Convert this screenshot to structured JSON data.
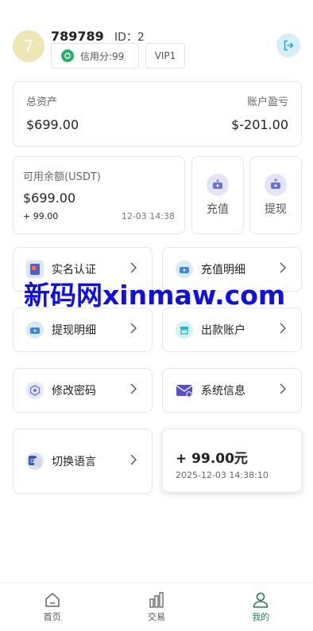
{
  "user": {
    "avatar_letter": "7",
    "name": "789789",
    "id_text": "ID：2",
    "credit_label": "信用分:99",
    "vip_label": "VIP1"
  },
  "assets": {
    "total_label": "总资产",
    "total_value": "$699.00",
    "pnl_label": "账户盈亏",
    "pnl_value": "$-201.00"
  },
  "balance": {
    "label": "可用余额(USDT)",
    "value": "$699.00",
    "change": "+ 99.00",
    "time": "12-03 14:38"
  },
  "actions": {
    "deposit": "充值",
    "withdraw": "提现"
  },
  "menu": {
    "verify": "实名认证",
    "deposit_detail": "充值明细",
    "withdraw_detail": "提现明细",
    "payout_account": "出款账户",
    "change_password": "修改密码",
    "system_message": "系统信息",
    "switch_language": "切换语言"
  },
  "toast": {
    "amount": "+ 99.00元",
    "time": "2025-12-03 14:38:10"
  },
  "watermark": "新码网xinmaw.com",
  "tabs": {
    "home": "首页",
    "trade": "交易",
    "mine": "我的"
  },
  "colors": {
    "accent_green": "#2a7a57",
    "credit_green": "#2cae6a",
    "avatar_bg": "#ece7b4",
    "icon_bg": "#e3e4f7",
    "watermark_blue": "#1010e0"
  }
}
